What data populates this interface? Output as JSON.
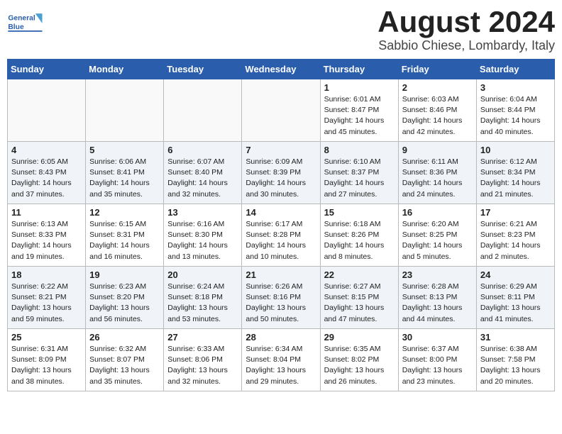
{
  "header": {
    "logo_general": "General",
    "logo_blue": "Blue",
    "month": "August 2024",
    "location": "Sabbio Chiese, Lombardy, Italy"
  },
  "days_of_week": [
    "Sunday",
    "Monday",
    "Tuesday",
    "Wednesday",
    "Thursday",
    "Friday",
    "Saturday"
  ],
  "weeks": [
    [
      {
        "day": "",
        "info": ""
      },
      {
        "day": "",
        "info": ""
      },
      {
        "day": "",
        "info": ""
      },
      {
        "day": "",
        "info": ""
      },
      {
        "day": "1",
        "info": "Sunrise: 6:01 AM\nSunset: 8:47 PM\nDaylight: 14 hours\nand 45 minutes."
      },
      {
        "day": "2",
        "info": "Sunrise: 6:03 AM\nSunset: 8:46 PM\nDaylight: 14 hours\nand 42 minutes."
      },
      {
        "day": "3",
        "info": "Sunrise: 6:04 AM\nSunset: 8:44 PM\nDaylight: 14 hours\nand 40 minutes."
      }
    ],
    [
      {
        "day": "4",
        "info": "Sunrise: 6:05 AM\nSunset: 8:43 PM\nDaylight: 14 hours\nand 37 minutes."
      },
      {
        "day": "5",
        "info": "Sunrise: 6:06 AM\nSunset: 8:41 PM\nDaylight: 14 hours\nand 35 minutes."
      },
      {
        "day": "6",
        "info": "Sunrise: 6:07 AM\nSunset: 8:40 PM\nDaylight: 14 hours\nand 32 minutes."
      },
      {
        "day": "7",
        "info": "Sunrise: 6:09 AM\nSunset: 8:39 PM\nDaylight: 14 hours\nand 30 minutes."
      },
      {
        "day": "8",
        "info": "Sunrise: 6:10 AM\nSunset: 8:37 PM\nDaylight: 14 hours\nand 27 minutes."
      },
      {
        "day": "9",
        "info": "Sunrise: 6:11 AM\nSunset: 8:36 PM\nDaylight: 14 hours\nand 24 minutes."
      },
      {
        "day": "10",
        "info": "Sunrise: 6:12 AM\nSunset: 8:34 PM\nDaylight: 14 hours\nand 21 minutes."
      }
    ],
    [
      {
        "day": "11",
        "info": "Sunrise: 6:13 AM\nSunset: 8:33 PM\nDaylight: 14 hours\nand 19 minutes."
      },
      {
        "day": "12",
        "info": "Sunrise: 6:15 AM\nSunset: 8:31 PM\nDaylight: 14 hours\nand 16 minutes."
      },
      {
        "day": "13",
        "info": "Sunrise: 6:16 AM\nSunset: 8:30 PM\nDaylight: 14 hours\nand 13 minutes."
      },
      {
        "day": "14",
        "info": "Sunrise: 6:17 AM\nSunset: 8:28 PM\nDaylight: 14 hours\nand 10 minutes."
      },
      {
        "day": "15",
        "info": "Sunrise: 6:18 AM\nSunset: 8:26 PM\nDaylight: 14 hours\nand 8 minutes."
      },
      {
        "day": "16",
        "info": "Sunrise: 6:20 AM\nSunset: 8:25 PM\nDaylight: 14 hours\nand 5 minutes."
      },
      {
        "day": "17",
        "info": "Sunrise: 6:21 AM\nSunset: 8:23 PM\nDaylight: 14 hours\nand 2 minutes."
      }
    ],
    [
      {
        "day": "18",
        "info": "Sunrise: 6:22 AM\nSunset: 8:21 PM\nDaylight: 13 hours\nand 59 minutes."
      },
      {
        "day": "19",
        "info": "Sunrise: 6:23 AM\nSunset: 8:20 PM\nDaylight: 13 hours\nand 56 minutes."
      },
      {
        "day": "20",
        "info": "Sunrise: 6:24 AM\nSunset: 8:18 PM\nDaylight: 13 hours\nand 53 minutes."
      },
      {
        "day": "21",
        "info": "Sunrise: 6:26 AM\nSunset: 8:16 PM\nDaylight: 13 hours\nand 50 minutes."
      },
      {
        "day": "22",
        "info": "Sunrise: 6:27 AM\nSunset: 8:15 PM\nDaylight: 13 hours\nand 47 minutes."
      },
      {
        "day": "23",
        "info": "Sunrise: 6:28 AM\nSunset: 8:13 PM\nDaylight: 13 hours\nand 44 minutes."
      },
      {
        "day": "24",
        "info": "Sunrise: 6:29 AM\nSunset: 8:11 PM\nDaylight: 13 hours\nand 41 minutes."
      }
    ],
    [
      {
        "day": "25",
        "info": "Sunrise: 6:31 AM\nSunset: 8:09 PM\nDaylight: 13 hours\nand 38 minutes."
      },
      {
        "day": "26",
        "info": "Sunrise: 6:32 AM\nSunset: 8:07 PM\nDaylight: 13 hours\nand 35 minutes."
      },
      {
        "day": "27",
        "info": "Sunrise: 6:33 AM\nSunset: 8:06 PM\nDaylight: 13 hours\nand 32 minutes."
      },
      {
        "day": "28",
        "info": "Sunrise: 6:34 AM\nSunset: 8:04 PM\nDaylight: 13 hours\nand 29 minutes."
      },
      {
        "day": "29",
        "info": "Sunrise: 6:35 AM\nSunset: 8:02 PM\nDaylight: 13 hours\nand 26 minutes."
      },
      {
        "day": "30",
        "info": "Sunrise: 6:37 AM\nSunset: 8:00 PM\nDaylight: 13 hours\nand 23 minutes."
      },
      {
        "day": "31",
        "info": "Sunrise: 6:38 AM\nSunset: 7:58 PM\nDaylight: 13 hours\nand 20 minutes."
      }
    ]
  ]
}
